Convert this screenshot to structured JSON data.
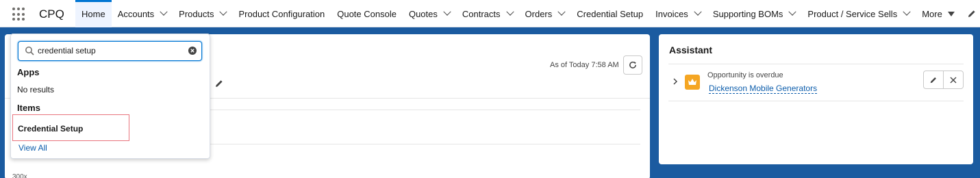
{
  "app": {
    "name": "CPQ"
  },
  "nav": {
    "tabs": [
      {
        "label": "Home",
        "active": true,
        "dropdown": false
      },
      {
        "label": "Accounts",
        "dropdown": true
      },
      {
        "label": "Products",
        "dropdown": true
      },
      {
        "label": "Product Configuration",
        "dropdown": false
      },
      {
        "label": "Quote Console",
        "dropdown": false
      },
      {
        "label": "Quotes",
        "dropdown": true
      },
      {
        "label": "Contracts",
        "dropdown": true
      },
      {
        "label": "Orders",
        "dropdown": true
      },
      {
        "label": "Credential Setup",
        "dropdown": false
      },
      {
        "label": "Invoices",
        "dropdown": true
      },
      {
        "label": "Supporting BOMs",
        "dropdown": true
      },
      {
        "label": "Product / Service Sells",
        "dropdown": true
      },
      {
        "label": "More",
        "dropdown": true
      }
    ]
  },
  "main": {
    "as_of": "As of Today 7:58 AM",
    "partial_text": "300x"
  },
  "assistant": {
    "title": "Assistant",
    "insight": {
      "type": "Opportunity is overdue",
      "link": "Dickenson Mobile Generators"
    }
  },
  "search": {
    "value": "credential setup",
    "sections": {
      "apps": "Apps",
      "apps_empty": "No results",
      "items": "Items"
    },
    "result": "Credential Setup",
    "view_all": "View All"
  },
  "colors": {
    "brand_blue": "#0176d3",
    "banner": "#1b5ba0",
    "link": "#0b5cab",
    "crown": "#f5a623",
    "highlight_border": "#e8737c"
  }
}
